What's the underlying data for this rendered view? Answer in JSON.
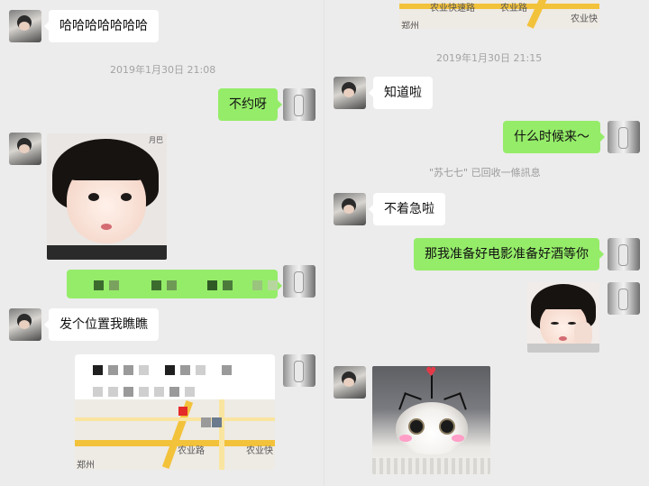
{
  "left_pane": {
    "msg1": "哈哈哈哈哈哈哈",
    "time1": "2019年1月30日 21:08",
    "msg_out1": "不约呀",
    "sticker_corner_text": "月巴",
    "msg3": "发个位置我瞧瞧",
    "map_labels": [
      "农业路",
      "农业快",
      "郑州"
    ]
  },
  "right_pane": {
    "top_map_labels": [
      "农业快速路",
      "农业路",
      "农业快",
      "郑州"
    ],
    "time1": "2019年1月30日 21:15",
    "msg1": "知道啦",
    "msg_out1": "什么时候来～",
    "recall_notice": "\"苏七七\" 已回收一條訊息",
    "msg2": "不着急啦",
    "msg_out2": "那我准备好电影准备好酒等你"
  },
  "icons": [
    "contact-avatar-girl",
    "self-avatar-photo",
    "heart-icon",
    "map-pin-icon"
  ],
  "colors": {
    "background": "#ececec",
    "outgoing_bubble": "#95ec69",
    "incoming_bubble": "#ffffff",
    "timestamp": "#a3a3a3"
  }
}
